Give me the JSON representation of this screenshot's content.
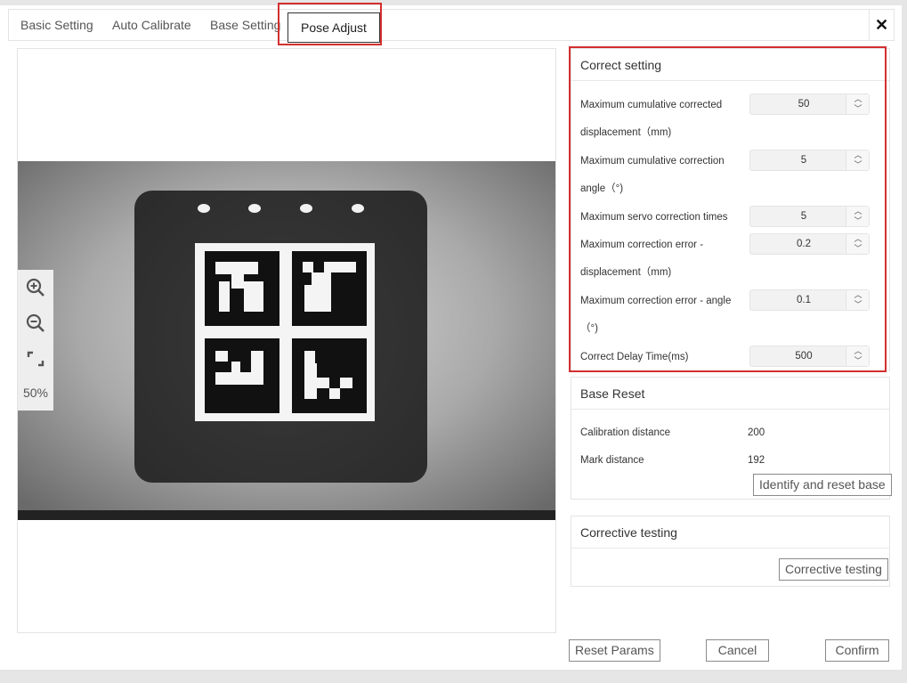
{
  "tabs": [
    "Basic Setting",
    "Auto Calibrate",
    "Base Setting",
    "Pose Adjust"
  ],
  "active_tab": "Pose Adjust",
  "close_label": "✕",
  "viewer": {
    "zoom_level": "50%"
  },
  "correct_setting": {
    "title": "Correct setting",
    "params": [
      {
        "label": "Maximum cumulative corrected displacement（mm)",
        "value": "50"
      },
      {
        "label": "Maximum cumulative correction angle（°)",
        "value": "5"
      },
      {
        "label": "Maximum servo correction times",
        "value": "5"
      },
      {
        "label": "Maximum correction error - displacement（mm)",
        "value": "0.2"
      },
      {
        "label": "Maximum correction error - angle（°)",
        "value": "0.1"
      },
      {
        "label": "Correct Delay Time(ms)",
        "value": "500"
      }
    ]
  },
  "base_reset": {
    "title": "Base Reset",
    "calibration_label": "Calibration distance",
    "calibration_value": "200",
    "mark_label": "Mark distance",
    "mark_value": "192",
    "button": "Identify and reset base"
  },
  "corrective_testing": {
    "title": "Corrective testing",
    "button": "Corrective testing"
  },
  "footer": {
    "reset": "Reset Params",
    "cancel": "Cancel",
    "confirm": "Confirm"
  },
  "colors": {
    "highlight": "#d32f2f",
    "border": "#e4e4e4"
  }
}
